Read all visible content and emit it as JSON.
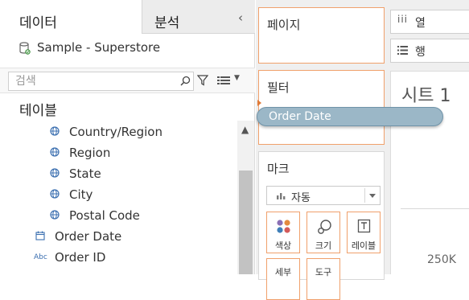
{
  "left_pane": {
    "tab_data": "데이터",
    "tab_analysis": "분석",
    "collapse_glyph": "‹",
    "data_source": "Sample - Superstore",
    "search_placeholder": "검색",
    "section_title": "테이블",
    "fields": [
      {
        "name": "Country/Region",
        "icon": "globe-icon"
      },
      {
        "name": "Region",
        "icon": "globe-icon"
      },
      {
        "name": "State",
        "icon": "globe-icon"
      },
      {
        "name": "City",
        "icon": "globe-icon"
      },
      {
        "name": "Postal Code",
        "icon": "globe-icon"
      },
      {
        "name": "Order Date",
        "icon": "calendar-icon"
      },
      {
        "name": "Order ID",
        "icon": "abc-icon",
        "badge": "Abc"
      }
    ]
  },
  "shelves": {
    "pages_title": "페이지",
    "filters_title": "필터",
    "marks_title": "마크",
    "mark_type": "자동",
    "mark_buttons": [
      "색상",
      "크기",
      "레이블",
      "세부",
      "도구"
    ],
    "columns_label": "열",
    "rows_label": "행",
    "columns_glyph": "iii"
  },
  "drag_pill": {
    "label": "Order Date"
  },
  "view": {
    "sheet_title": "시트 1",
    "axis_tick": "250K"
  },
  "colors": {
    "accent_orange": "#f0a06b",
    "pill_blue": "#9bb7c7",
    "globe_blue": "#3b6fb0"
  }
}
